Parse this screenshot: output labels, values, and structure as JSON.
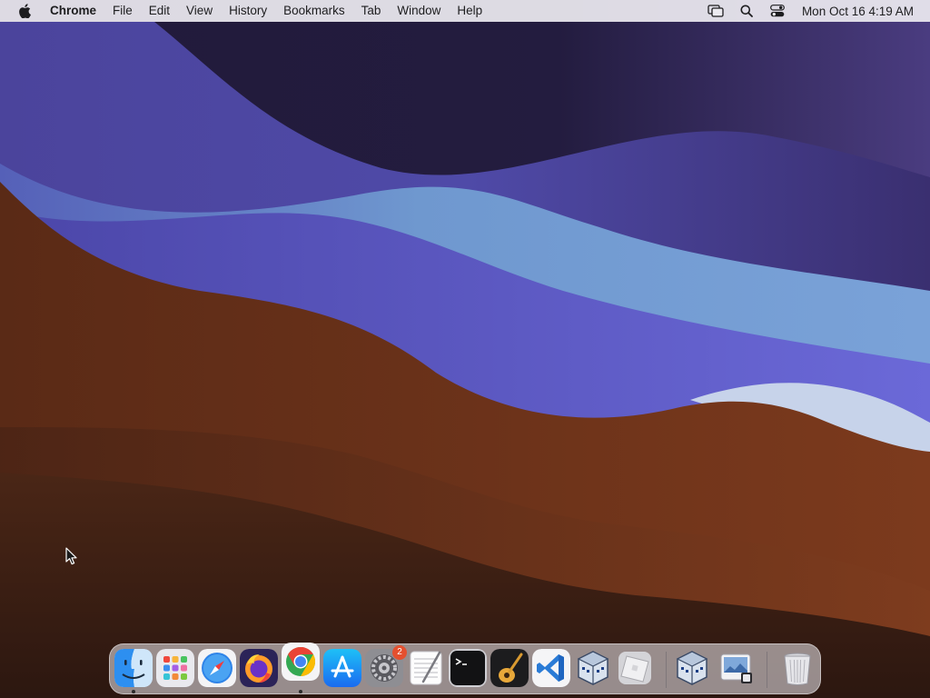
{
  "menubar": {
    "app_name": "Chrome",
    "menus": [
      "File",
      "Edit",
      "View",
      "History",
      "Bookmarks",
      "Tab",
      "Window",
      "Help"
    ],
    "status_icons": [
      "screen-mirroring-icon",
      "spotlight-search-icon",
      "control-center-icon"
    ],
    "clock": "Mon Oct 16  4:19 AM"
  },
  "dock": {
    "apps": [
      {
        "name": "Finder",
        "icon": "finder-icon",
        "running": true
      },
      {
        "name": "Launchpad",
        "icon": "launchpad-icon",
        "running": false
      },
      {
        "name": "Safari",
        "icon": "safari-icon",
        "running": false
      },
      {
        "name": "Firefox",
        "icon": "firefox-icon",
        "running": false
      },
      {
        "name": "Google Chrome",
        "icon": "chrome-icon",
        "running": true
      },
      {
        "name": "App Store",
        "icon": "app-store-icon",
        "running": false
      },
      {
        "name": "System Settings",
        "icon": "system-settings-icon",
        "running": false,
        "badge": "2"
      },
      {
        "name": "TextEdit",
        "icon": "textedit-icon",
        "running": false
      },
      {
        "name": "Terminal",
        "icon": "terminal-icon",
        "running": false
      },
      {
        "name": "GarageBand",
        "icon": "garageband-icon",
        "running": false
      },
      {
        "name": "Visual Studio Code",
        "icon": "vscode-icon",
        "running": false
      },
      {
        "name": "VirtualBox",
        "icon": "virtualbox-icon",
        "running": false
      },
      {
        "name": "Roblox",
        "icon": "roblox-icon",
        "running": false
      }
    ],
    "extras": [
      {
        "name": "VirtualBox",
        "icon": "virtualbox-icon"
      },
      {
        "name": "Preview",
        "icon": "preview-icon"
      }
    ],
    "trash": {
      "name": "Trash",
      "icon": "trash-icon"
    }
  },
  "colors": {
    "wallpaper_top": "#2a1d4a",
    "wallpaper_blue": "#5b55c4",
    "wallpaper_light_blue": "#7ea4d6",
    "wallpaper_brown": "#6b3219",
    "wallpaper_dark_brown": "#3a1e12",
    "badge": "#e4502f"
  }
}
